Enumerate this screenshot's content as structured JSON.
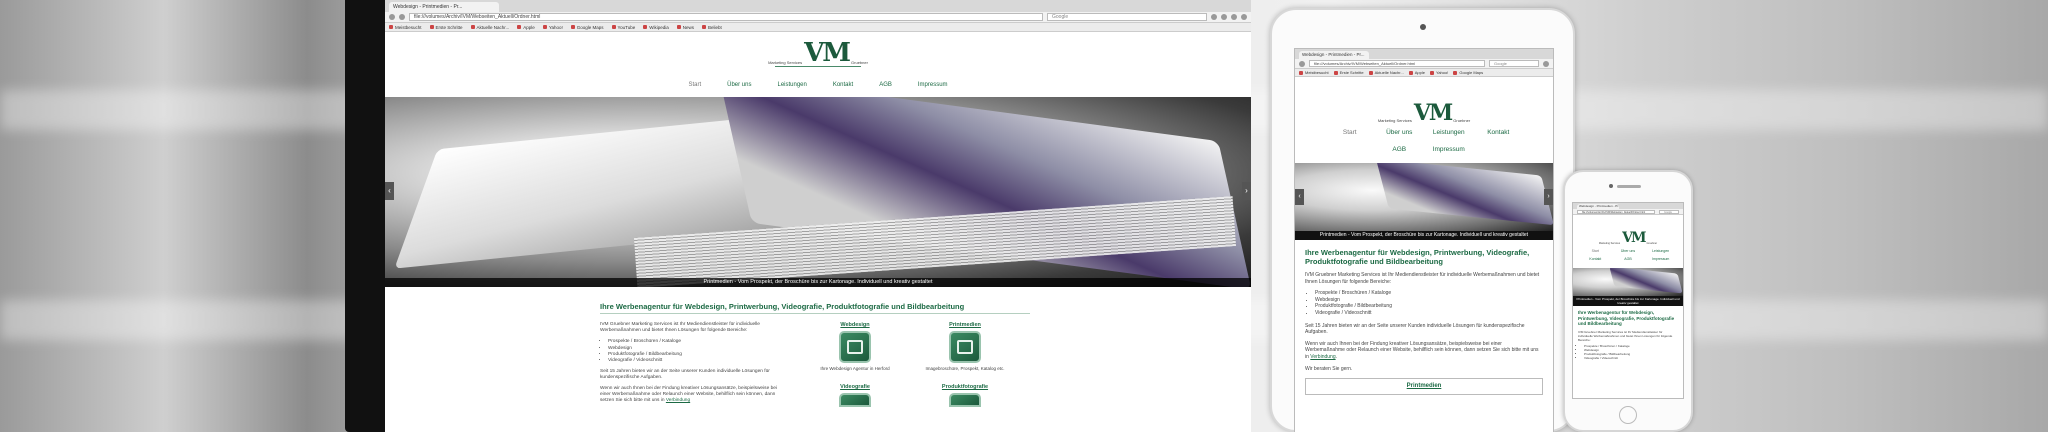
{
  "site": {
    "logo_small": "Marketing Services",
    "logo_big": "VM",
    "logo_sub": "Gruebner",
    "nav": [
      "Start",
      "Über uns",
      "Leistungen",
      "Kontakt",
      "AGB",
      "Impressum"
    ],
    "hero_caption": "Printmedien - Vom Prospekt, der Broschüre bis zur Kartonage. Individuell und kreativ gestaltet",
    "heading": "Ihre Werbenagentur für Webdesign, Printwerbung, Videografie, Produktfotografie und Bildbearbeitung",
    "intro": "IVM Gruebner Marketing Services ist Ihr Mediendienstleister für individuelle Werbemaßnahmen und bietet Ihnen Lösungen für folgende Bereiche:",
    "bullets": [
      "Prospekte / Broschüren / Kataloge",
      "Webdesign",
      "Produktfotografie / Bildbearbeitung",
      "Videografie / Videoschnitt"
    ],
    "para2": "Seit 15 Jahren bieten wir an der Seite unserer Kunden individuelle Lösungen für kundenspezifische Aufgaben.",
    "para3": "Wenn wir auch Ihnen bei der Findung kreativer Lösungsansätze, beispielsweise bei einer Werbemaßnahme oder Relaunch einer Website, behilflich sein können, dann setzen Sie sich bitte mit uns in",
    "para3_link": "Verbindung",
    "para4": "Wir beraten Sie gern.",
    "services": [
      {
        "label": "Webdesign",
        "desc": "Ihre Webdesign Agentur in Herford"
      },
      {
        "label": "Printmedien",
        "desc": "Imagebroschüre, Prospekt, Katalog etc."
      },
      {
        "label": "Videografie",
        "desc": ""
      },
      {
        "label": "Produktfotografie",
        "desc": ""
      }
    ]
  },
  "browser": {
    "tab_title": "Webdesign - Printmedien - Pr...",
    "url": "file:///volumes/Archiv/IVM/Webseiten_Aktuell/Ordner.html",
    "search_placeholder": "Google",
    "bookmarks": [
      "Meistbesucht",
      "Erste Schritte",
      "Aktuelle Nachr...",
      "Apple",
      "Yahoo!",
      "Google Maps",
      "YouTube",
      "Wikipedia",
      "News",
      "Beliebt"
    ]
  },
  "colors": {
    "brand_green": "#1c6a44",
    "nav_active": "#777777"
  }
}
